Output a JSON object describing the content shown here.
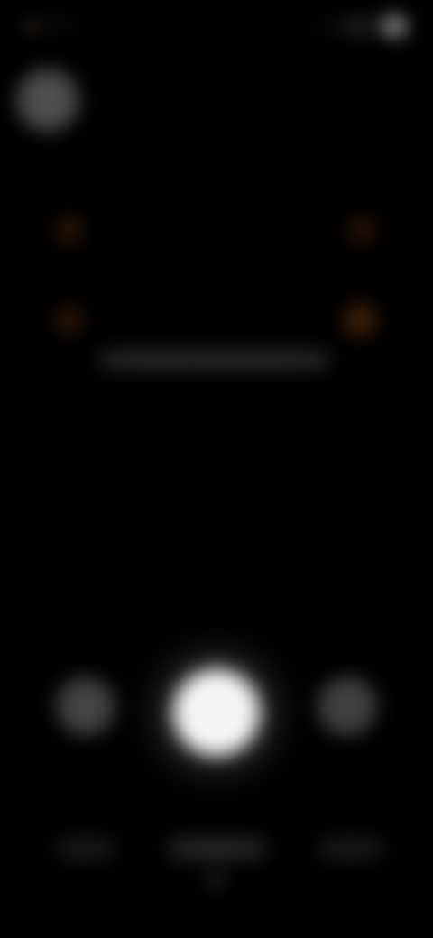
{
  "status_bar": {
    "time": "9:41",
    "network": "4G",
    "battery": "80"
  },
  "viewfinder": {
    "hint": "Align QR code within frame"
  },
  "controls": {
    "left_label": "Album",
    "center_label": "Scan",
    "right_label": "Light"
  },
  "colors": {
    "background": "#000000",
    "accent": "#3a1d08",
    "shutter": "#f4f4f4"
  }
}
